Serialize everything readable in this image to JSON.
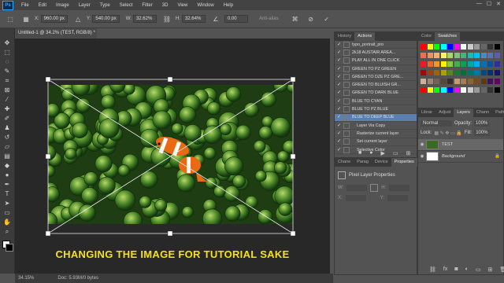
{
  "menubar": {
    "logo": "Ps",
    "items": [
      "File",
      "Edit",
      "Image",
      "Layer",
      "Type",
      "Select",
      "Filter",
      "3D",
      "View",
      "Window",
      "Help"
    ],
    "window_controls": [
      "—",
      "☐",
      "✕"
    ]
  },
  "options": {
    "x_label": "X:",
    "x_value": "960.00 px",
    "y_label": "Y:",
    "y_value": "540.00 px",
    "w_label": "W:",
    "w_value": "32.62%",
    "h_label": "H:",
    "h_value": "32.64%",
    "angle_value": "0.00",
    "interp": "Anti-alias"
  },
  "document": {
    "tab_title": "Untitled-1 @ 34.2% (TEST, RGB/8) *",
    "caption": "CHANGING THE IMAGE FOR TUTORIAL SAKE",
    "zoom": "34.15%",
    "doc_info": "Doc: 5.93M/0 bytes"
  },
  "history_panel": {
    "tabs": [
      "History",
      "Actions"
    ],
    "rows": [
      {
        "label": "typo_portrait_pro",
        "selected": false
      },
      {
        "label": "2k18 AUSTAIR AREA...",
        "selected": false
      },
      {
        "label": "PLAY ALL IN ONE CLICK",
        "selected": false
      },
      {
        "label": "GREEN TO PZ GREEN",
        "selected": false
      },
      {
        "label": "GREEN TO DZE PZ GRE...",
        "selected": false
      },
      {
        "label": "GREEN TO BLUISH GR...",
        "selected": false
      },
      {
        "label": "GREEN TO DARK BLUE",
        "selected": false
      },
      {
        "label": "BLUE TO CYAN",
        "selected": false
      },
      {
        "label": "BLUE TO PZ BLUE",
        "selected": false
      },
      {
        "label": "BLUE TO DEEP BLUE",
        "selected": true
      },
      {
        "label": "Layer Via Copy",
        "selected": false
      },
      {
        "label": "Rasterize current layer",
        "selected": false
      },
      {
        "label": "Set current layer",
        "selected": false
      },
      {
        "label": "Selective Color",
        "selected": false
      }
    ]
  },
  "properties_panel": {
    "tabs": [
      "Chane",
      "Parag",
      "Device",
      "Properties"
    ],
    "title": "Pixel Layer Properties",
    "w_label": "W:",
    "h_label": "H:",
    "x_label": "X:",
    "y_label": "Y:"
  },
  "swatches_panel": {
    "tabs": [
      "Color",
      "Swatches"
    ]
  },
  "layers_panel": {
    "tabs": [
      "Librar",
      "Adjust",
      "Layers",
      "Chann",
      "Paths"
    ],
    "blend_mode": "Normal",
    "opacity_label": "Opacity:",
    "opacity": "100%",
    "lock_label": "Lock:",
    "fill_label": "Fill:",
    "fill": "100%",
    "layers": [
      {
        "name": "TEST"
      },
      {
        "name": "Background"
      }
    ]
  }
}
